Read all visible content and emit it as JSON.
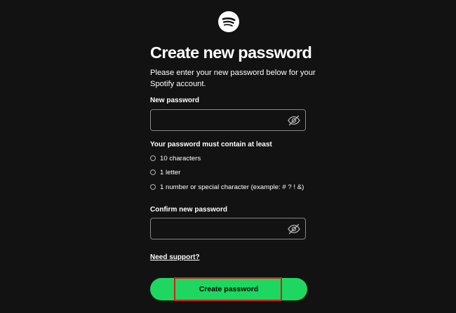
{
  "brand": {
    "logo_icon": "spotify-logo-icon",
    "logo_color": "#ffffff"
  },
  "page": {
    "title": "Create new password",
    "subtitle": "Please enter your new password below for your Spotify account."
  },
  "new_password": {
    "label": "New password",
    "value": "",
    "toggle_icon": "eye-off-icon"
  },
  "requirements": {
    "title": "Your password must contain at least",
    "items": [
      {
        "text": "10 characters",
        "met": false
      },
      {
        "text": "1 letter",
        "met": false
      },
      {
        "text": "1 number or special character (example: # ? ! &)",
        "met": false
      }
    ]
  },
  "confirm_password": {
    "label": "Confirm new password",
    "value": "",
    "toggle_icon": "eye-off-icon"
  },
  "support_link": "Need support?",
  "submit": {
    "label": "Create password",
    "color": "#1ed760",
    "highlight_color": "#d0201e"
  }
}
